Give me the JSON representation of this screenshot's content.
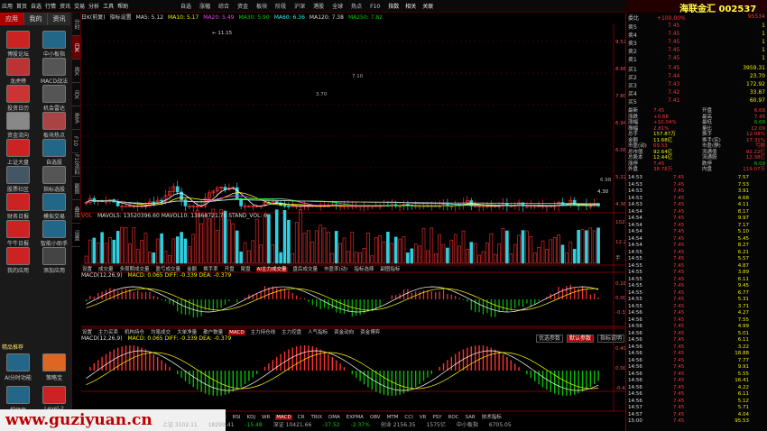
{
  "top_bar": {
    "menu_items": [
      "应用",
      "首页",
      "自选",
      "行情",
      "资讯",
      "交易",
      "分析",
      "工具",
      "帮助"
    ],
    "toolbar": [
      "自选",
      "涨幅",
      "综合",
      "资金",
      "板块",
      "阶段",
      "沪深",
      "港股",
      "全球",
      "热点",
      "F10"
    ],
    "right_tools": [
      "指数",
      "相关",
      "关联"
    ],
    "stock_header": "海联金汇 002537"
  },
  "left_panel": {
    "tabs": [
      "应用",
      "我的",
      "资讯"
    ],
    "apps": [
      "博股论坛",
      "中小板指",
      "龙虎榜",
      "MACD战法",
      "投资日历",
      "机会雷达",
      "资金流向",
      "板块热点",
      "上证大盘",
      "自选股",
      "股票社区",
      "指标选股",
      "财务日报",
      "模拟交易",
      "牛牛日报",
      "智能小助手",
      "我的应用",
      "添加应用"
    ],
    "featured_title": "精品推荐",
    "featured": [
      "AI分时功能",
      "策略宝",
      "超级宝",
      "Level-2"
    ]
  },
  "chart_tabs": [
    "分时",
    "日K",
    "周K",
    "月K",
    "更多",
    "F10",
    "F10资料",
    "副图",
    "叠加",
    "设置"
  ],
  "chart_header": [
    {
      "t": "日K(前复)",
      "c": "wht"
    },
    {
      "t": "指标设置",
      "c": "wht"
    },
    {
      "t": "MA5: 5.12",
      "c": "wht"
    },
    {
      "t": "MA10: 5.17",
      "c": "yel"
    },
    {
      "t": "MA20: 5.49",
      "c": "mag"
    },
    {
      "t": "MA30: 5.90",
      "c": "grn"
    },
    {
      "t": "MA60: 6.36",
      "c": "cyn"
    },
    {
      "t": "MA120: 7.38",
      "c": "wht"
    },
    {
      "t": "MA250: 7.82",
      "c": "grn"
    }
  ],
  "kline_data": {
    "max_label": "11.15",
    "min_label": "4.30",
    "notes": [
      "3.70",
      "7.10",
      "6.98"
    ],
    "side_prices": [
      "9.52",
      "8.66",
      "7.80",
      "6.94",
      "6.08",
      "5.22",
      "4.36"
    ]
  },
  "volume_panel": {
    "label": "VOL",
    "text": "MAVOL5: 13520396.60   MAVOL10: 13868721.70   STAND_VOL: 0",
    "scale": [
      "102.86",
      "12.27"
    ],
    "unit": "手"
  },
  "indicator_tabs_1": [
    "设置",
    "成交量",
    "多周期成交量",
    "盈亏成交量",
    "金额",
    "换手率",
    "开盘",
    "尾盘",
    "AI主力成交量",
    "盘后成交量",
    "市盈率(动)",
    "指标选择",
    "副图指标"
  ],
  "macd1": {
    "title": "MACD(12,26,9)",
    "text": "MACD: 0.065   DIFF: -0.339   DEA: -0.379",
    "scale": [
      "0.187",
      "0.00",
      "-0.389"
    ]
  },
  "indicator_tabs_2": [
    "设置",
    "主力买卖",
    "机构持仓",
    "均笔成交",
    "大单净量",
    "散户数量",
    "MACD",
    "主力持仓线",
    "主力控盘",
    "人气指标",
    "资金动向",
    "资金博弈"
  ],
  "macd2": {
    "title": "MACD(12,26,9)",
    "text": "MACD: 0.065   DIFF: -0.339   DEA: -0.379",
    "scale": [
      "0.497",
      "0.00",
      "-0.489"
    ],
    "buttons": [
      "优选参数",
      "默认参数",
      "指标说明"
    ]
  },
  "bottom_tabs": [
    "ASI",
    "BRAR",
    "BOLL",
    "DMI",
    "RSI",
    "KDJ",
    "WR",
    "MACD",
    "CR",
    "TRIX",
    "DMA",
    "EXPMA",
    "OBV",
    "MTM",
    "CCI",
    "VR",
    "PSY",
    "ROC",
    "SAR",
    "技术指标"
  ],
  "quote": {
    "committee": "委比",
    "committee_val": "+100.00%",
    "committee_num": "95534",
    "sells": [
      [
        "卖5",
        "7.45",
        "1"
      ],
      [
        "卖4",
        "7.45",
        "1"
      ],
      [
        "卖3",
        "7.45",
        "1"
      ],
      [
        "卖2",
        "7.45",
        "1"
      ],
      [
        "卖1",
        "7.45",
        "1"
      ]
    ],
    "buys": [
      [
        "买1",
        "7.45",
        "3959.31"
      ],
      [
        "买2",
        "7.44",
        "23.70"
      ],
      [
        "买3",
        "7.43",
        "172.92"
      ],
      [
        "买4",
        "7.42",
        "33.87"
      ],
      [
        "买5",
        "7.41",
        "60.97"
      ]
    ],
    "stats": [
      [
        "最新",
        "7.45",
        "开盘",
        "6.68"
      ],
      [
        "涨跌",
        "+0.68",
        "最高",
        "7.45"
      ],
      [
        "涨幅",
        "+10.04%",
        "最低",
        "6.68"
      ],
      [
        "振幅",
        "2.81%",
        "量比",
        "12.09"
      ],
      [
        "总手",
        "157.87万",
        "换手",
        "12.08%"
      ],
      [
        "金额",
        "11.68亿",
        "换手(实)",
        "17.31%"
      ],
      [
        "市盈(动)",
        "69.53",
        "市盈(静)",
        "亏损"
      ],
      [
        "总市值",
        "92.64亿",
        "流通值",
        "92.22亿"
      ],
      [
        "总股本",
        "12.44亿",
        "流通股",
        "12.38亿"
      ],
      [
        "涨停",
        "7.45",
        "跌停",
        "6.09"
      ],
      [
        "外盘",
        "38.78万",
        "内盘",
        "119.07万"
      ]
    ]
  },
  "ticks": [
    [
      "14:53",
      "7.45",
      "7.57"
    ],
    [
      "14:53",
      "7.45",
      "7.53"
    ],
    [
      "14:53",
      "7.45",
      "3.91"
    ],
    [
      "14:53",
      "7.45",
      "4.68"
    ],
    [
      "14:53",
      "7.45",
      "4.11"
    ],
    [
      "14:54",
      "7.45",
      "8.17"
    ],
    [
      "14:54",
      "7.45",
      "9.97"
    ],
    [
      "14:54",
      "7.45",
      "7.17"
    ],
    [
      "14:54",
      "7.45",
      "5.10"
    ],
    [
      "14:54",
      "7.45",
      "5.45"
    ],
    [
      "14:54",
      "7.45",
      "8.27"
    ],
    [
      "14:55",
      "7.45",
      "6.21"
    ],
    [
      "14:55",
      "7.45",
      "5.57"
    ],
    [
      "14:55",
      "7.45",
      "4.87"
    ],
    [
      "14:55",
      "7.45",
      "3.89"
    ],
    [
      "14:55",
      "7.45",
      "6.11"
    ],
    [
      "14:55",
      "7.45",
      "9.45"
    ],
    [
      "14:55",
      "7.45",
      "6.77"
    ],
    [
      "14:55",
      "7.45",
      "5.31"
    ],
    [
      "14:55",
      "7.45",
      "3.71"
    ],
    [
      "14:56",
      "7.45",
      "4.27"
    ],
    [
      "14:56",
      "7.45",
      "7.55"
    ],
    [
      "14:56",
      "7.45",
      "4.99"
    ],
    [
      "14:56",
      "7.45",
      "5.01"
    ],
    [
      "14:56",
      "7.45",
      "6.11"
    ],
    [
      "14:56",
      "7.45",
      "3.22"
    ],
    [
      "14:56",
      "7.45",
      "18.88"
    ],
    [
      "14:56",
      "7.45",
      "7.77"
    ],
    [
      "14:56",
      "7.45",
      "9.91"
    ],
    [
      "14:56",
      "7.45",
      "5.55"
    ],
    [
      "14:56",
      "7.45",
      "16.41"
    ],
    [
      "14:56",
      "7.45",
      "4.22"
    ],
    [
      "14:56",
      "7.45",
      "6.11"
    ],
    [
      "14:56",
      "7.45",
      "5.12"
    ],
    [
      "14:57",
      "7.45",
      "5.71"
    ],
    [
      "14:57",
      "7.45",
      "4.04"
    ],
    [
      "15:00",
      "7.45",
      "95.53"
    ]
  ],
  "bottom_status": [
    "上证 3102.11",
    "18299.41",
    "-15.48",
    "深证 10421.66",
    "-37.52",
    "-2.37%",
    "创业 2156.35",
    "1575亿",
    "中小板指",
    "6705.05"
  ],
  "watermark": "www.guziyuan.cn",
  "colors": {
    "up": "#ff3030",
    "down": "#00d0d0",
    "bg": "#000000",
    "accent": "#ee0000"
  }
}
